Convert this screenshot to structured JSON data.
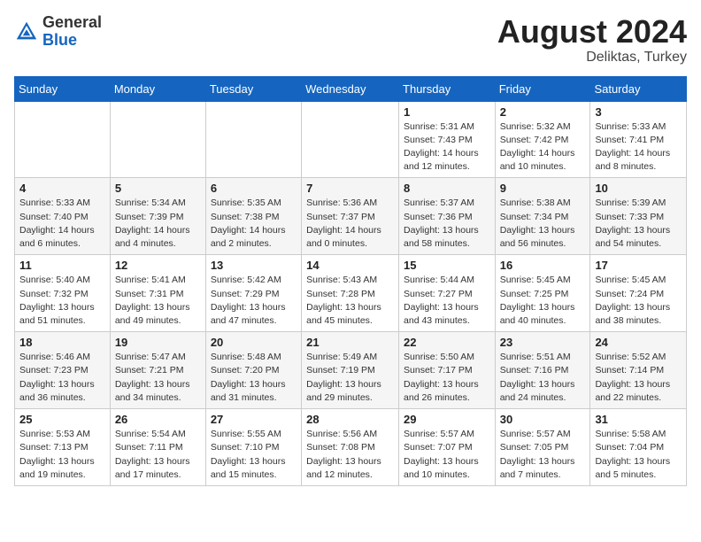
{
  "header": {
    "logo_general": "General",
    "logo_blue": "Blue",
    "month_year": "August 2024",
    "location": "Deliktas, Turkey"
  },
  "calendar": {
    "days_of_week": [
      "Sunday",
      "Monday",
      "Tuesday",
      "Wednesday",
      "Thursday",
      "Friday",
      "Saturday"
    ],
    "weeks": [
      [
        {
          "day": "",
          "info": ""
        },
        {
          "day": "",
          "info": ""
        },
        {
          "day": "",
          "info": ""
        },
        {
          "day": "",
          "info": ""
        },
        {
          "day": "1",
          "info": "Sunrise: 5:31 AM\nSunset: 7:43 PM\nDaylight: 14 hours\nand 12 minutes."
        },
        {
          "day": "2",
          "info": "Sunrise: 5:32 AM\nSunset: 7:42 PM\nDaylight: 14 hours\nand 10 minutes."
        },
        {
          "day": "3",
          "info": "Sunrise: 5:33 AM\nSunset: 7:41 PM\nDaylight: 14 hours\nand 8 minutes."
        }
      ],
      [
        {
          "day": "4",
          "info": "Sunrise: 5:33 AM\nSunset: 7:40 PM\nDaylight: 14 hours\nand 6 minutes."
        },
        {
          "day": "5",
          "info": "Sunrise: 5:34 AM\nSunset: 7:39 PM\nDaylight: 14 hours\nand 4 minutes."
        },
        {
          "day": "6",
          "info": "Sunrise: 5:35 AM\nSunset: 7:38 PM\nDaylight: 14 hours\nand 2 minutes."
        },
        {
          "day": "7",
          "info": "Sunrise: 5:36 AM\nSunset: 7:37 PM\nDaylight: 14 hours\nand 0 minutes."
        },
        {
          "day": "8",
          "info": "Sunrise: 5:37 AM\nSunset: 7:36 PM\nDaylight: 13 hours\nand 58 minutes."
        },
        {
          "day": "9",
          "info": "Sunrise: 5:38 AM\nSunset: 7:34 PM\nDaylight: 13 hours\nand 56 minutes."
        },
        {
          "day": "10",
          "info": "Sunrise: 5:39 AM\nSunset: 7:33 PM\nDaylight: 13 hours\nand 54 minutes."
        }
      ],
      [
        {
          "day": "11",
          "info": "Sunrise: 5:40 AM\nSunset: 7:32 PM\nDaylight: 13 hours\nand 51 minutes."
        },
        {
          "day": "12",
          "info": "Sunrise: 5:41 AM\nSunset: 7:31 PM\nDaylight: 13 hours\nand 49 minutes."
        },
        {
          "day": "13",
          "info": "Sunrise: 5:42 AM\nSunset: 7:29 PM\nDaylight: 13 hours\nand 47 minutes."
        },
        {
          "day": "14",
          "info": "Sunrise: 5:43 AM\nSunset: 7:28 PM\nDaylight: 13 hours\nand 45 minutes."
        },
        {
          "day": "15",
          "info": "Sunrise: 5:44 AM\nSunset: 7:27 PM\nDaylight: 13 hours\nand 43 minutes."
        },
        {
          "day": "16",
          "info": "Sunrise: 5:45 AM\nSunset: 7:25 PM\nDaylight: 13 hours\nand 40 minutes."
        },
        {
          "day": "17",
          "info": "Sunrise: 5:45 AM\nSunset: 7:24 PM\nDaylight: 13 hours\nand 38 minutes."
        }
      ],
      [
        {
          "day": "18",
          "info": "Sunrise: 5:46 AM\nSunset: 7:23 PM\nDaylight: 13 hours\nand 36 minutes."
        },
        {
          "day": "19",
          "info": "Sunrise: 5:47 AM\nSunset: 7:21 PM\nDaylight: 13 hours\nand 34 minutes."
        },
        {
          "day": "20",
          "info": "Sunrise: 5:48 AM\nSunset: 7:20 PM\nDaylight: 13 hours\nand 31 minutes."
        },
        {
          "day": "21",
          "info": "Sunrise: 5:49 AM\nSunset: 7:19 PM\nDaylight: 13 hours\nand 29 minutes."
        },
        {
          "day": "22",
          "info": "Sunrise: 5:50 AM\nSunset: 7:17 PM\nDaylight: 13 hours\nand 26 minutes."
        },
        {
          "day": "23",
          "info": "Sunrise: 5:51 AM\nSunset: 7:16 PM\nDaylight: 13 hours\nand 24 minutes."
        },
        {
          "day": "24",
          "info": "Sunrise: 5:52 AM\nSunset: 7:14 PM\nDaylight: 13 hours\nand 22 minutes."
        }
      ],
      [
        {
          "day": "25",
          "info": "Sunrise: 5:53 AM\nSunset: 7:13 PM\nDaylight: 13 hours\nand 19 minutes."
        },
        {
          "day": "26",
          "info": "Sunrise: 5:54 AM\nSunset: 7:11 PM\nDaylight: 13 hours\nand 17 minutes."
        },
        {
          "day": "27",
          "info": "Sunrise: 5:55 AM\nSunset: 7:10 PM\nDaylight: 13 hours\nand 15 minutes."
        },
        {
          "day": "28",
          "info": "Sunrise: 5:56 AM\nSunset: 7:08 PM\nDaylight: 13 hours\nand 12 minutes."
        },
        {
          "day": "29",
          "info": "Sunrise: 5:57 AM\nSunset: 7:07 PM\nDaylight: 13 hours\nand 10 minutes."
        },
        {
          "day": "30",
          "info": "Sunrise: 5:57 AM\nSunset: 7:05 PM\nDaylight: 13 hours\nand 7 minutes."
        },
        {
          "day": "31",
          "info": "Sunrise: 5:58 AM\nSunset: 7:04 PM\nDaylight: 13 hours\nand 5 minutes."
        }
      ]
    ]
  }
}
